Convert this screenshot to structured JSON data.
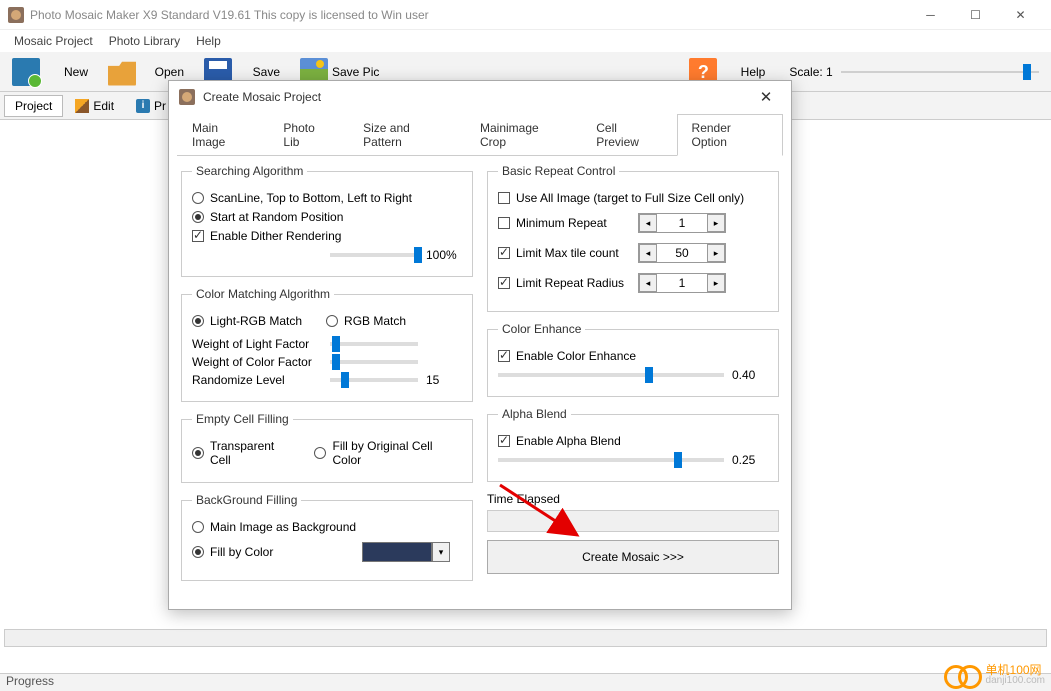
{
  "window": {
    "title": "Photo Mosaic Maker X9 Standard V19.61   This copy is licensed to Win user"
  },
  "menu": {
    "project": "Mosaic Project",
    "library": "Photo Library",
    "help": "Help"
  },
  "toolbar": {
    "new": "New",
    "open": "Open",
    "save": "Save",
    "savepic": "Save Pic",
    "help": "Help",
    "scale_label": "Scale: 1"
  },
  "toolbar2": {
    "project": "Project",
    "edit": "Edit",
    "pr": "Pr"
  },
  "status": {
    "progress": "Progress"
  },
  "watermark": {
    "brand": "单机100网",
    "url": "danji100.com"
  },
  "dialog": {
    "title": "Create Mosaic Project",
    "tabs": [
      "Main Image",
      "Photo Lib",
      "Size and Pattern",
      "Mainimage Crop",
      "Cell Preview",
      "Render Option"
    ],
    "search": {
      "legend": "Searching Algorithm",
      "scanline": "ScanLine, Top to Bottom, Left to Right",
      "random": "Start at Random Position",
      "dither": "Enable Dither Rendering",
      "dither_val": "100%"
    },
    "colormatch": {
      "legend": "Color Matching Algorithm",
      "lightrgb": "Light-RGB Match",
      "rgb": "RGB Match",
      "wlight": "Weight of Light Factor",
      "wcolor": "Weight of Color Factor",
      "rand": "Randomize Level",
      "rand_val": "15"
    },
    "empty": {
      "legend": "Empty Cell Filling",
      "transparent": "Transparent Cell",
      "original": "Fill by Original Cell Color"
    },
    "bg": {
      "legend": "BackGround Filling",
      "main": "Main Image as Background",
      "color": "Fill by Color"
    },
    "repeat": {
      "legend": "Basic Repeat Control",
      "useall": "Use All Image (target to Full Size Cell only)",
      "minrepeat": "Minimum Repeat",
      "minrepeat_val": "1",
      "maxtile": "Limit Max tile count",
      "maxtile_val": "50",
      "radius": "Limit Repeat Radius",
      "radius_val": "1"
    },
    "enhance": {
      "legend": "Color Enhance",
      "enable": "Enable Color Enhance",
      "val": "0.40"
    },
    "alpha": {
      "legend": "Alpha Blend",
      "enable": "Enable Alpha Blend",
      "val": "0.25"
    },
    "time": {
      "legend": "Time Elapsed"
    },
    "create": "Create Mosaic >>>"
  }
}
